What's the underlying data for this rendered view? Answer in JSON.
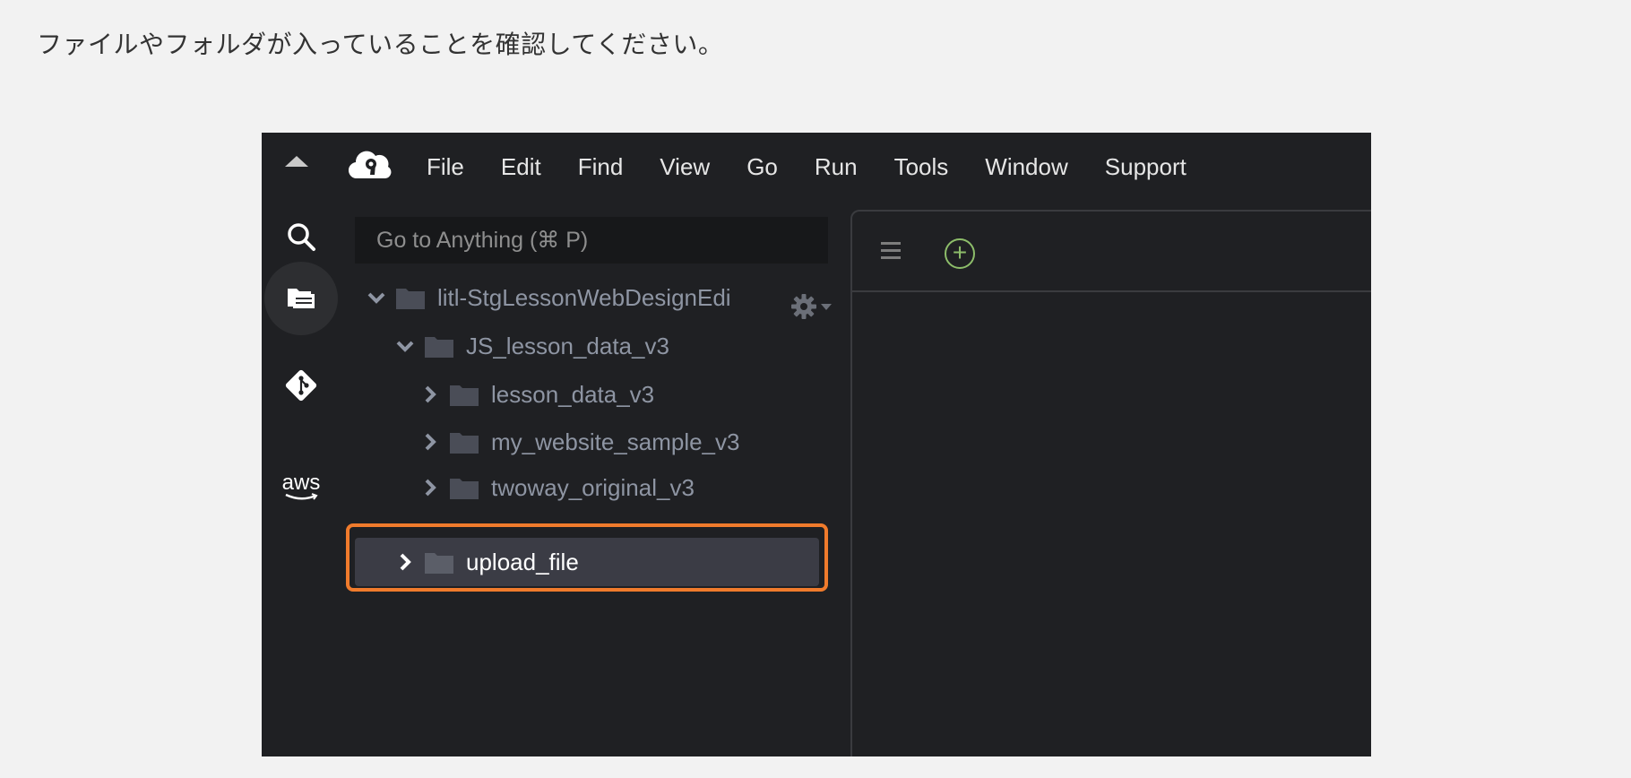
{
  "instruction": "ファイルやフォルダが入っていることを確認してください。",
  "menu": [
    "File",
    "Edit",
    "Find",
    "View",
    "Go",
    "Run",
    "Tools",
    "Window",
    "Support"
  ],
  "goto": {
    "placeholder": "Go to Anything (⌘ P)"
  },
  "aws_label": "aws",
  "tree": [
    {
      "label": "litl-StgLessonWebDesignEdi",
      "expanded": true,
      "level": 0
    },
    {
      "label": "JS_lesson_data_v3",
      "expanded": true,
      "level": 1
    },
    {
      "label": "lesson_data_v3",
      "expanded": false,
      "level": 2
    },
    {
      "label": "my_website_sample_v3",
      "expanded": false,
      "level": 2
    },
    {
      "label": "twoway_original_v3",
      "expanded": false,
      "level": 2
    },
    {
      "label": "upload_file",
      "expanded": false,
      "level": 1,
      "selected": true
    }
  ],
  "colors": {
    "highlight": "#f07b2c",
    "add_tab": "#8dbd6a",
    "background": "#1f2023"
  }
}
